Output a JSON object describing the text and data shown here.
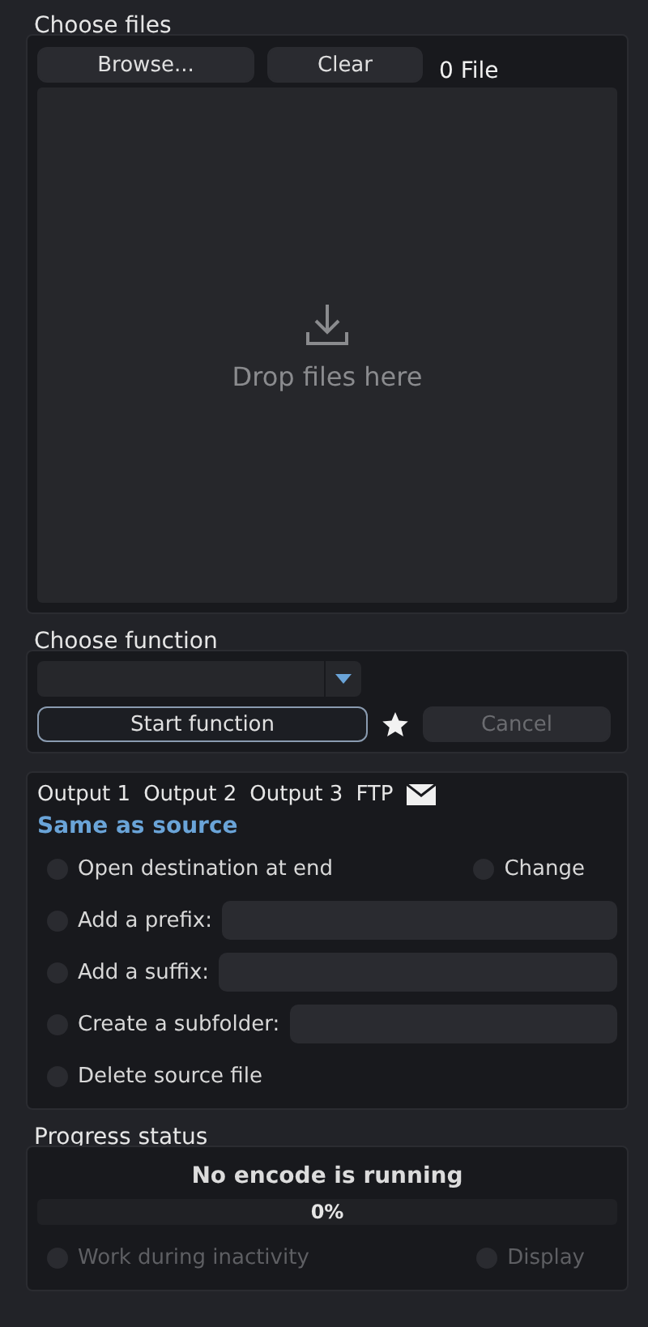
{
  "files": {
    "title": "Choose files",
    "buttons": [
      "Browse...",
      "Clear"
    ],
    "count": "0 File",
    "drop_label": "Drop files here"
  },
  "function": {
    "title": "Choose function",
    "start": "Start function",
    "cancel": "Cancel",
    "cancel_disabled": true
  },
  "output": {
    "tabs": [
      "Output 1",
      "Output 2",
      "Output 3",
      "FTP"
    ],
    "destination": "Same as source",
    "options": [
      {
        "kind": "pair",
        "label": "Open destination at end",
        "checked": false,
        "side_label": "Change",
        "side_checked": false
      },
      {
        "kind": "field",
        "label": "Add a prefix:",
        "checked": false
      },
      {
        "kind": "field",
        "label": "Add a suffix:",
        "checked": false
      },
      {
        "kind": "field",
        "label": "Create a subfolder:",
        "checked": false
      },
      {
        "kind": "plain",
        "label": "Delete source file",
        "checked": false
      }
    ]
  },
  "progress": {
    "title": "Progress status",
    "status": "No encode is running",
    "reading": "0%",
    "options": [
      {
        "label": "Work during inactivity",
        "checked": false,
        "disabled": true
      },
      {
        "label": "Display",
        "checked": false,
        "disabled": true
      }
    ]
  }
}
